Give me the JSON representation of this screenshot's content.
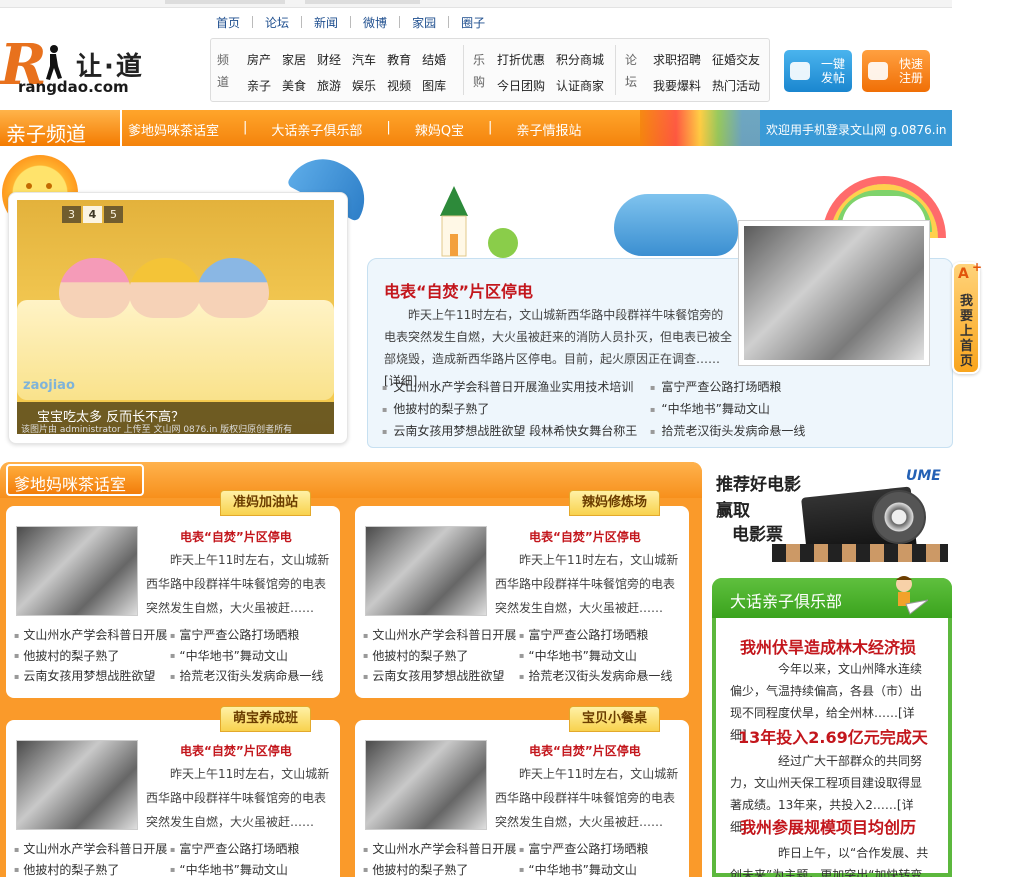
{
  "brand": {
    "cn": "让·道",
    "en": "rangdao.com"
  },
  "topnav": [
    "首页",
    "论坛",
    "新闻",
    "微博",
    "家园",
    "圈子"
  ],
  "channels": {
    "pindao": {
      "label": "频道",
      "row1": [
        "房产",
        "家居",
        "财经",
        "汽车",
        "教育",
        "结婚"
      ],
      "row2": [
        "亲子",
        "美食",
        "旅游",
        "娱乐",
        "视频",
        "图库"
      ]
    },
    "legou": {
      "label": "乐购",
      "row1": [
        "打折优惠",
        "积分商城"
      ],
      "row2": [
        "今日团购",
        "认证商家"
      ]
    },
    "luntan": {
      "label": "论坛",
      "row1": [
        "求职招聘",
        "征婚交友"
      ],
      "row2": [
        "我要爆料",
        "热门活动"
      ]
    }
  },
  "buttons": {
    "post": "一键发帖",
    "register": "快速注册"
  },
  "channel_bar": {
    "title": "亲子频道",
    "links": [
      "爹地妈咪茶话室",
      "大话亲子俱乐部",
      "辣妈Q宝",
      "亲子情报站"
    ],
    "welcome": "欢迎用手机登录文山网 g.0876.in"
  },
  "slideshow": {
    "pages": [
      "3",
      "4",
      "5"
    ],
    "active": "4",
    "caption": "宝宝吃太多 反而长不高？",
    "info": "该图片由 administrator 上传至 文山网 0876.in 版权归原创者所有",
    "watermark": "zaojiao"
  },
  "hero_news": {
    "title": "电表“自焚”片区停电",
    "body": "昨天上午11时左右，文山城新西华路中段群祥牛味餐馆旁的电表突然发生自燃，大火虽被赶来的消防人员扑灭，但电表已被全部烧毁，造成新西华路片区停电。目前，起火原因正在调查……",
    "more": "[详细]",
    "list": [
      "文山州水产学会科普日开展渔业实用技术培训",
      "富宁严查公路打场晒粮",
      "他披村的梨子熟了",
      "“中华地书”舞动文山",
      "云南女孩用梦想战胜欲望 段林希快女舞台称王",
      "拾荒老汉街头发病命悬一线"
    ]
  },
  "side_tab": {
    "letter": "A",
    "plus": "+",
    "text": "我要上首页"
  },
  "section": {
    "title": "爹地妈咪茶话室"
  },
  "cards": [
    {
      "tag": "准妈加油站",
      "title": "电表“自焚”片区停电",
      "body": "昨天上午11时左右，文山城新西华路中段群祥牛味餐馆旁的电表突然发生自燃，大火虽被赶……",
      "list": [
        "文山州水产学会科普日开展",
        "富宁严查公路打场晒粮",
        "他披村的梨子熟了",
        "“中华地书”舞动文山",
        "云南女孩用梦想战胜欲望",
        "拾荒老汉街头发病命悬一线"
      ]
    },
    {
      "tag": "辣妈修炼场",
      "title": "电表“自焚”片区停电",
      "body": "昨天上午11时左右，文山城新西华路中段群祥牛味餐馆旁的电表突然发生自燃，大火虽被赶……",
      "list": [
        "文山州水产学会科普日开展",
        "富宁严查公路打场晒粮",
        "他披村的梨子熟了",
        "“中华地书”舞动文山",
        "云南女孩用梦想战胜欲望",
        "拾荒老汉街头发病命悬一线"
      ]
    },
    {
      "tag": "萌宝养成班",
      "title": "电表“自焚”片区停电",
      "body": "昨天上午11时左右，文山城新西华路中段群祥牛味餐馆旁的电表突然发生自燃，大火虽被赶……",
      "list": [
        "文山州水产学会科普日开展",
        "富宁严查公路打场晒粮",
        "他披村的梨子熟了",
        "“中华地书”舞动文山"
      ]
    },
    {
      "tag": "宝贝小餐桌",
      "title": "电表“自焚”片区停电",
      "body": "昨天上午11时左右，文山城新西华路中段群祥牛味餐馆旁的电表突然发生自燃，大火虽被赶……",
      "list": [
        "文山州水产学会科普日开展",
        "富宁严查公路打场晒粮",
        "他披村的梨子熟了",
        "“中华地书”舞动文山"
      ]
    }
  ],
  "movie_ad": {
    "line1": "推荐好电影",
    "line2": "赢取",
    "line3": "电影票",
    "logo": "UME"
  },
  "club": {
    "title": "大话亲子俱乐部",
    "items": [
      {
        "title": "我州伏旱造成林木经济损",
        "body": "今年以来，文山州降水连续偏少，气温持续偏高，各县（市）出现不同程度伏旱，给全州林……[详细]"
      },
      {
        "title": "13年投入2.69亿元完成天",
        "body": "经过广大干部群众的共同努力，文山州天保工程项目建设取得显著成绩。13年来，共投入2……[详细]"
      },
      {
        "title": "我州参展规模项目均创历",
        "body": "昨日上午，以“合作发展、共创未来”为主题，更加突出“加快转变"
      }
    ]
  }
}
